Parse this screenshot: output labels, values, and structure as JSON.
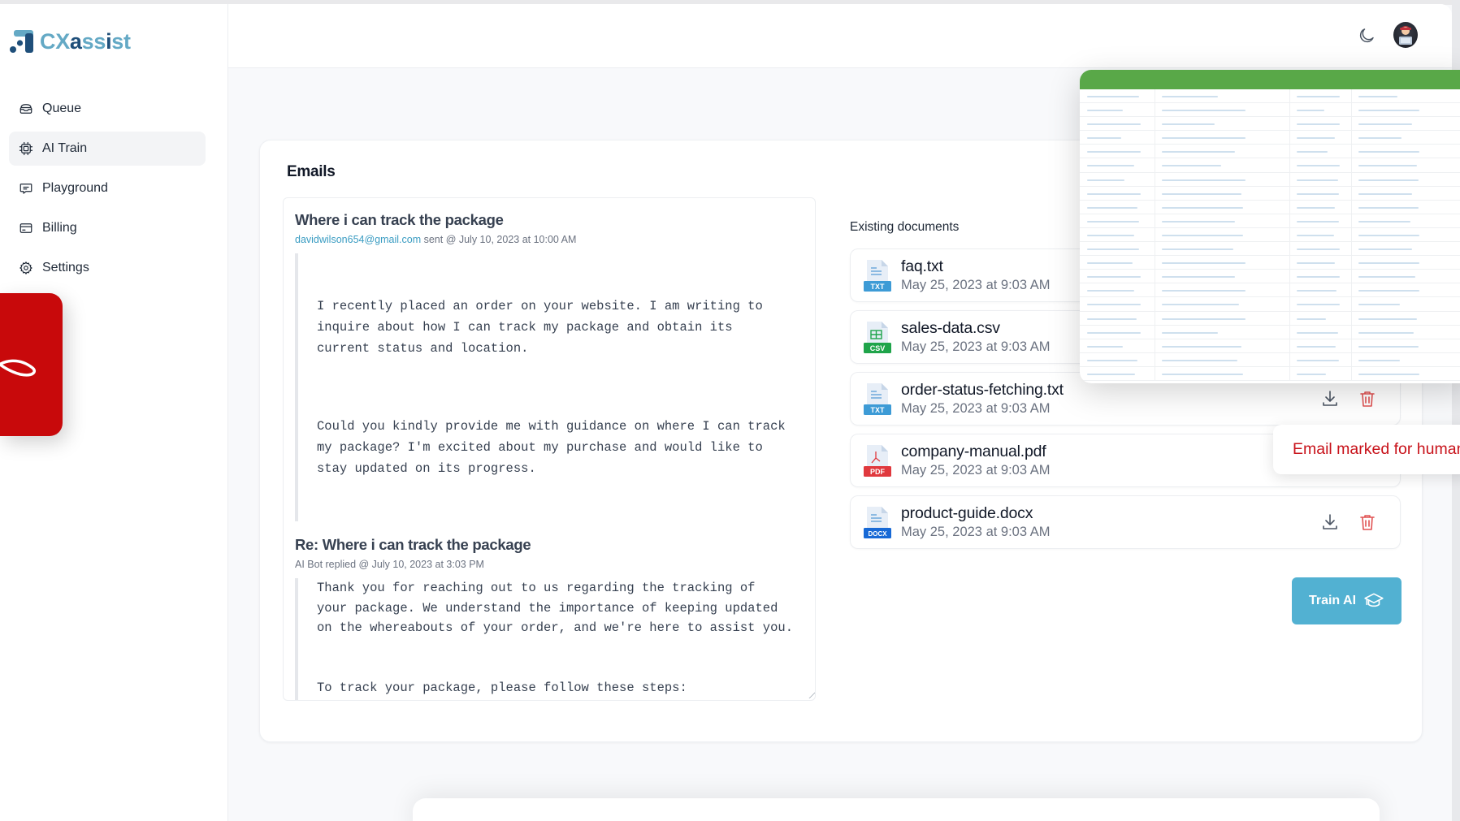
{
  "brand": {
    "name_parts": [
      {
        "text": "CX",
        "tone": "light"
      },
      {
        "text": "a",
        "tone": "dark"
      },
      {
        "text": "ss",
        "tone": "light"
      },
      {
        "text": "i",
        "tone": "dark"
      },
      {
        "text": "st",
        "tone": "light"
      }
    ],
    "colors": {
      "light": "#64a9c5",
      "dark": "#1f4f7a"
    }
  },
  "sidebar": {
    "items": [
      {
        "label": "Queue",
        "icon": "inbox-icon",
        "active": false
      },
      {
        "label": "AI Train",
        "icon": "cpu-icon",
        "active": true
      },
      {
        "label": "Playground",
        "icon": "chat-icon",
        "active": false
      },
      {
        "label": "Billing",
        "icon": "credit-card-icon",
        "active": false
      },
      {
        "label": "Settings",
        "icon": "gear-icon",
        "active": false
      }
    ]
  },
  "header": {
    "theme_toggle_icon": "moon-icon",
    "avatar_icon": "user-avatar"
  },
  "emails": {
    "title": "Emails",
    "original": {
      "subject": "Where i can track the package",
      "from": "davidwilson654@gmail.com",
      "meta": " sent @ July 10, 2023 at 10:00 AM",
      "paragraphs": [
        "I recently placed an order on your website. I am writing to\ninquire about how I can track my package and obtain its\ncurrent status and location.",
        "Could you kindly provide me with guidance on where I can track\nmy package? I'm excited about my purchase and would like to\nstay updated on its progress."
      ]
    },
    "reply": {
      "subject": "Re: Where i can track the package",
      "meta": "AI Bot replied @ July 10, 2023 at 3:03 PM",
      "body": "Thank you for reaching out to us regarding the tracking of\nyour package. We understand the importance of keeping updated\non the whereabouts of your order, and we're here to assist you.\n\n\nTo track your package, please follow these steps:\n\n- Visit our website.\n- Log in to your account using your registered email address\n  and password.\n- Once logged in, navigate to the \"Order History\" or\n  \"Track My Order\" section. This can typically be found under"
    }
  },
  "documents": {
    "label": "Existing documents",
    "items": [
      {
        "name": "faq.txt",
        "date": "May 25, 2023 at 9:03 AM",
        "type": "TXT",
        "color": "#3d9bd6"
      },
      {
        "name": "sales-data.csv",
        "date": "May 25, 2023 at 9:03 AM",
        "type": "CSV",
        "color": "#1fa44a"
      },
      {
        "name": "order-status-fetching.txt",
        "date": "May 25, 2023 at 9:03 AM",
        "type": "TXT",
        "color": "#3d9bd6"
      },
      {
        "name": "company-manual.pdf",
        "date": "May 25, 2023 at 9:03 AM",
        "type": "PDF",
        "color": "#e0393e"
      },
      {
        "name": "product-guide.docx",
        "date": "May 25, 2023 at 9:03 AM",
        "type": "DOCX",
        "color": "#1769d6"
      }
    ],
    "train_button": "Train AI"
  },
  "toast": {
    "text": "Email marked for human review"
  },
  "colors": {
    "accent": "#52b1d2",
    "danger": "#e05252",
    "sheet_header": "#59a848",
    "overlay_red": "#c8090b"
  }
}
